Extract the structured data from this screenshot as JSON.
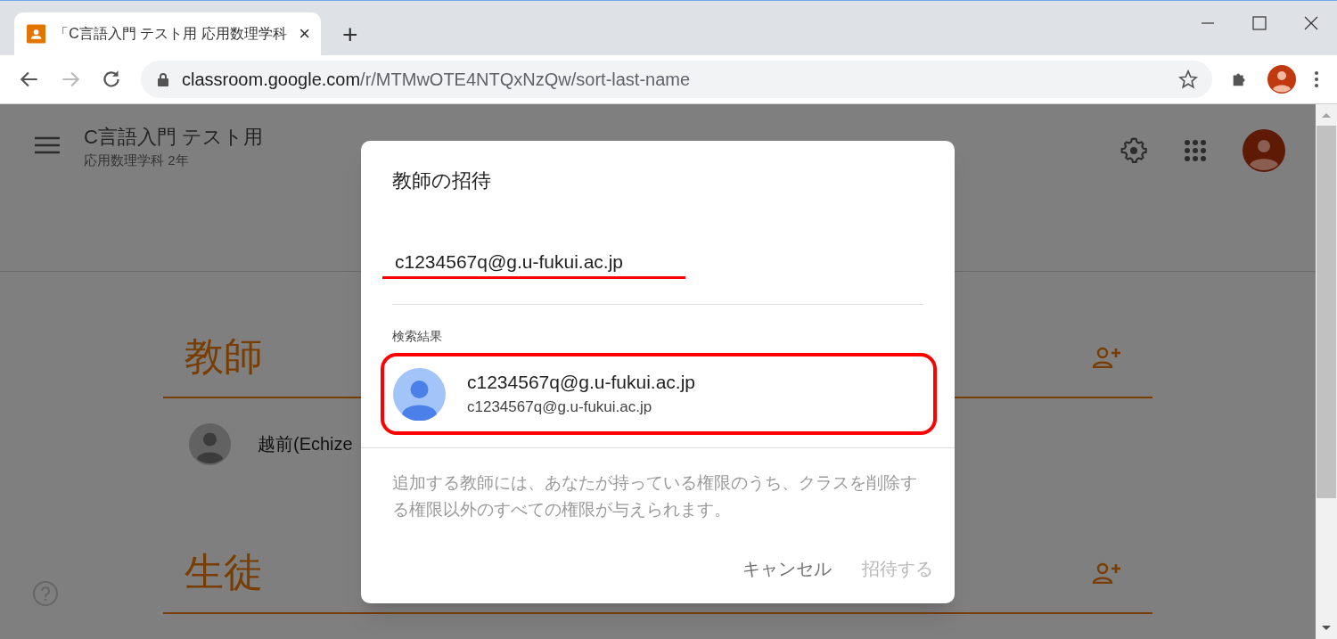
{
  "browser": {
    "tab": {
      "title": "「C言語入門 テスト用 応用数理学科",
      "close": "×"
    },
    "new_tab": "+",
    "url": {
      "host": "classroom.google.com",
      "path": "/r/MTMwOTE4NTQxNzQw/sort-last-name"
    }
  },
  "class_header": {
    "title": "C言語入門 テスト用",
    "subtitle": "応用数理学科 2年"
  },
  "sections": [
    {
      "heading": "教師",
      "people": [
        {
          "name": "越前(Echize"
        }
      ]
    },
    {
      "heading": "生徒"
    }
  ],
  "dialog": {
    "title": "教師の招待",
    "input_value": "c1234567q@g.u-fukui.ac.jp",
    "results_label": "検索結果",
    "result": {
      "name": "c1234567q@g.u-fukui.ac.jp",
      "email": "c1234567q@g.u-fukui.ac.jp"
    },
    "note": "追加する教師には、あなたが持っている権限のうち、クラスを削除する権限以外のすべての権限が与えられます。",
    "buttons": [
      {
        "label": "キャンセル",
        "disabled": false
      },
      {
        "label": "招待する",
        "disabled": true
      }
    ]
  }
}
